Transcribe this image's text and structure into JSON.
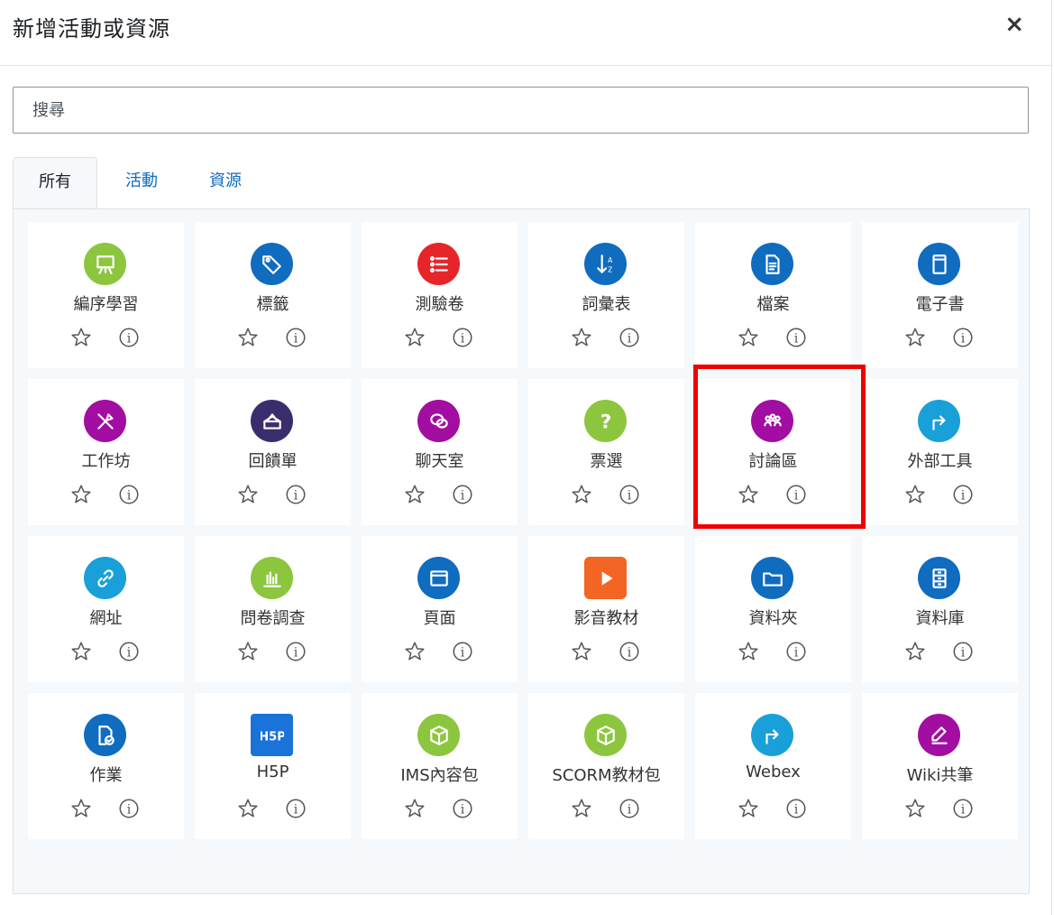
{
  "dialog": {
    "title": "新增活動或資源",
    "close_label": "×"
  },
  "search": {
    "placeholder": "搜尋"
  },
  "tabs": [
    {
      "label": "所有"
    },
    {
      "label": "活動"
    },
    {
      "label": "資源"
    }
  ],
  "items": [
    {
      "label": "編序學習",
      "icon": "lesson-icon",
      "color": "#8cc63f"
    },
    {
      "label": "標籤",
      "icon": "label-icon",
      "color": "#0f6cbf"
    },
    {
      "label": "測驗卷",
      "icon": "quiz-icon",
      "color": "#e6252b"
    },
    {
      "label": "詞彙表",
      "icon": "glossary-icon",
      "color": "#0f6cbf"
    },
    {
      "label": "檔案",
      "icon": "file-icon",
      "color": "#0f6cbf"
    },
    {
      "label": "電子書",
      "icon": "book-icon",
      "color": "#0f6cbf"
    },
    {
      "label": "工作坊",
      "icon": "workshop-icon",
      "color": "#a20da2"
    },
    {
      "label": "回饋單",
      "icon": "feedback-icon",
      "color": "#3a2d6e"
    },
    {
      "label": "聊天室",
      "icon": "chat-icon",
      "color": "#a20da2"
    },
    {
      "label": "票選",
      "icon": "choice-icon",
      "color": "#8cc63f"
    },
    {
      "label": "討論區",
      "icon": "forum-icon",
      "color": "#a20da2"
    },
    {
      "label": "外部工具",
      "icon": "external-tool-icon",
      "color": "#1aa0d8"
    },
    {
      "label": "網址",
      "icon": "url-icon",
      "color": "#1aa0d8"
    },
    {
      "label": "問卷調查",
      "icon": "survey-icon",
      "color": "#8cc63f"
    },
    {
      "label": "頁面",
      "icon": "page-icon",
      "color": "#0f6cbf"
    },
    {
      "label": "影音教材",
      "icon": "media-icon",
      "color": "#f26522"
    },
    {
      "label": "資料夾",
      "icon": "folder-icon",
      "color": "#0f6cbf"
    },
    {
      "label": "資料庫",
      "icon": "database-icon",
      "color": "#0f6cbf"
    },
    {
      "label": "作業",
      "icon": "assignment-icon",
      "color": "#0f6cbf"
    },
    {
      "label": "H5P",
      "icon": "h5p-icon",
      "color": "#1a73d9"
    },
    {
      "label": "IMS內容包",
      "icon": "ims-package-icon",
      "color": "#8cc63f"
    },
    {
      "label": "SCORM教材包",
      "icon": "scorm-package-icon",
      "color": "#8cc63f"
    },
    {
      "label": "Webex",
      "icon": "webex-icon",
      "color": "#1aa0d8"
    },
    {
      "label": "Wiki共筆",
      "icon": "wiki-icon",
      "color": "#a20da2"
    }
  ]
}
